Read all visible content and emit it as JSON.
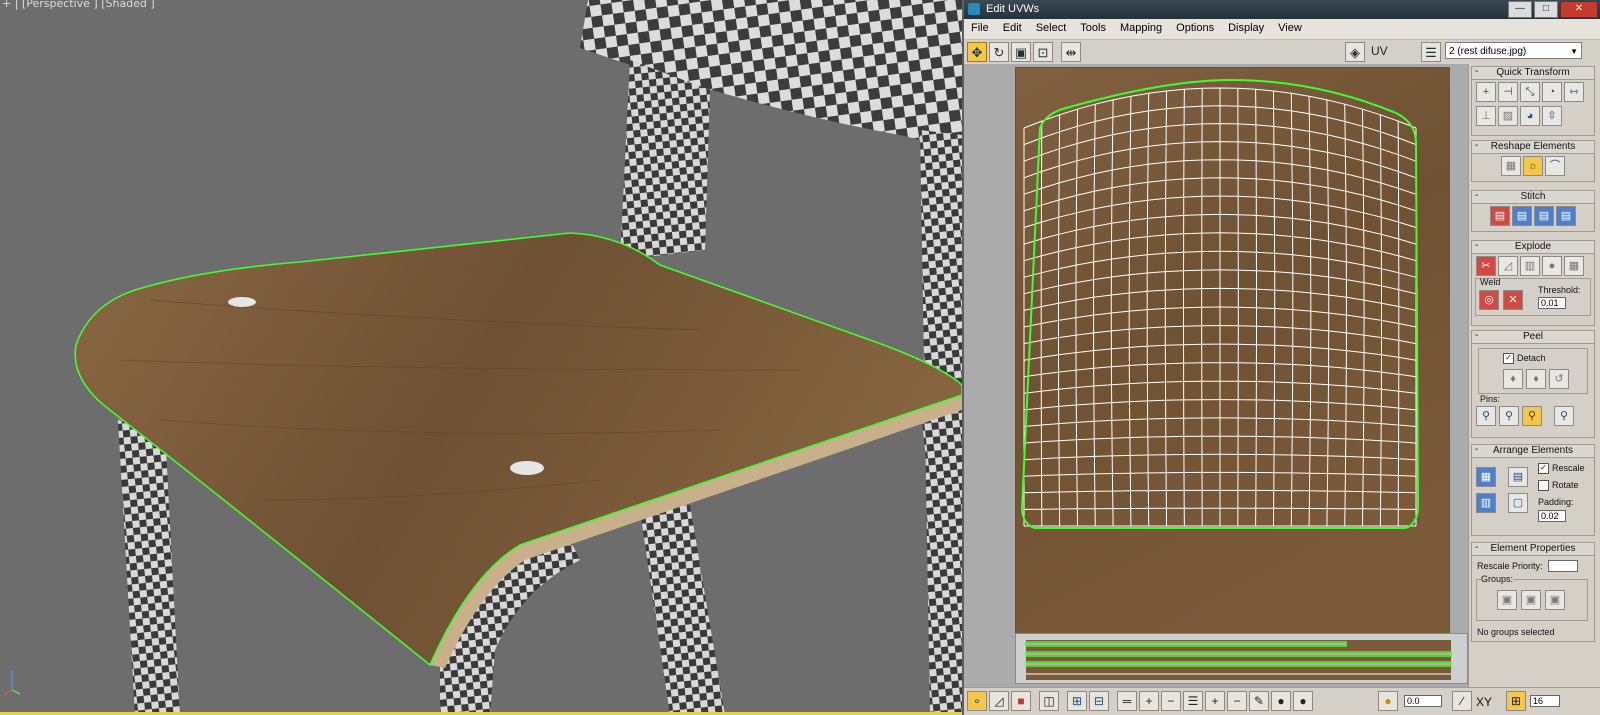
{
  "viewport": {
    "label": "+ | [Perspective ] [Shaded ]",
    "colors": {
      "background": "#6d6d6d",
      "wood": "#7b5a3a",
      "selection": "#3dff2e",
      "checker_dark": "#3c3c3c",
      "checker_light": "#dcdcdc"
    }
  },
  "window": {
    "title": "Edit UVWs",
    "controls": [
      "minimize-icon",
      "maximize-icon",
      "close-icon"
    ]
  },
  "menubar": {
    "items": [
      "File",
      "Edit",
      "Select",
      "Tools",
      "Mapping",
      "Options",
      "Display",
      "View"
    ]
  },
  "toolbar": {
    "tools": [
      "move-icon",
      "rotate-icon",
      "scale-icon",
      "freeform-icon",
      "mirror-icon"
    ],
    "uv_label": "UV",
    "texture_select": "2 (rest difuse.jpg)"
  },
  "panel": {
    "quick_transform": {
      "title": "Quick Transform"
    },
    "reshape_elements": {
      "title": "Reshape Elements"
    },
    "stitch": {
      "title": "Stitch"
    },
    "explode": {
      "title": "Explode",
      "weld_label": "Weld",
      "threshold_label": "Threshold:",
      "threshold_value": "0.01"
    },
    "peel": {
      "title": "Peel",
      "detach_label": "Detach",
      "detach_checked": true,
      "pins_label": "Pins:"
    },
    "arrange_elements": {
      "title": "Arrange Elements",
      "rescale_label": "Rescale",
      "rescale_checked": true,
      "rotate_label": "Rotate",
      "rotate_checked": false,
      "padding_label": "Padding:",
      "padding_value": "0.02"
    },
    "element_properties": {
      "title": "Element Properties",
      "rescale_priority_label": "Rescale Priority:",
      "groups_label": "Groups:",
      "no_groups": "No groups selected"
    }
  },
  "statusbar": {
    "value": "0.0",
    "xy_label": "XY",
    "zoom_value": "16"
  }
}
